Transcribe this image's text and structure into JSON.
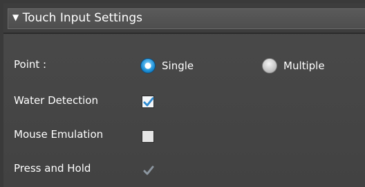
{
  "panel": {
    "header": {
      "arrow": "▼",
      "title": "Touch Input Settings"
    },
    "point": {
      "label": "Point :",
      "options": [
        {
          "label": "Single",
          "selected": true
        },
        {
          "label": "Multiple",
          "selected": false
        }
      ]
    },
    "water_detection": {
      "label": "Water Detection",
      "checked": true,
      "enabled": true
    },
    "mouse_emulation": {
      "label": "Mouse Emulation",
      "checked": false,
      "enabled": true
    },
    "press_and_hold": {
      "label": "Press and Hold",
      "checked": true,
      "enabled": false
    }
  },
  "colors": {
    "panel_bg": "#454545",
    "header_bg": "#555555",
    "text": "#ffffff",
    "radio_selected": "#1c8fd6",
    "check_mark": "#2f8ad0",
    "check_mark_disabled": "#8c96a0"
  }
}
